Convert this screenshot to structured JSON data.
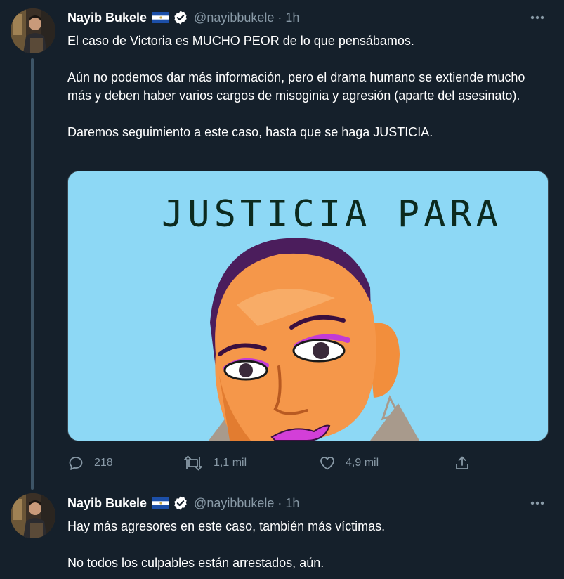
{
  "tweets": [
    {
      "author": {
        "name": "Nayib Bukele",
        "handle": "@nayibbukele",
        "flag": "flag-el-salvador-icon",
        "verified": true
      },
      "dot": "·",
      "time": "1h",
      "paragraphs": [
        "El caso de Victoria es MUCHO PEOR de lo que pensábamos.",
        "Aún no podemos dar más información, pero el drama humano se extiende mucho más y deben haber varios cargos de misoginia y agresión (aparte del asesinato).",
        "Daremos seguimiento a este caso, hasta que se haga JUSTICIA."
      ],
      "media": {
        "headline": "JUSTICIA PARA",
        "background": "#8dd8f5"
      },
      "actions": {
        "replies": "218",
        "retweets": "1,1 mil",
        "likes": "4,9 mil"
      }
    },
    {
      "author": {
        "name": "Nayib Bukele",
        "handle": "@nayibbukele",
        "flag": "flag-el-salvador-icon",
        "verified": true
      },
      "dot": "·",
      "time": "1h",
      "paragraphs": [
        "Hay más agresores en este caso, también más víctimas.",
        "No todos los culpables están arrestados, aún."
      ]
    }
  ],
  "colors": {
    "background": "#15202b",
    "secondary_text": "#8899a6",
    "thread_line": "#3d5466",
    "verified_badge": "#ffffff"
  }
}
